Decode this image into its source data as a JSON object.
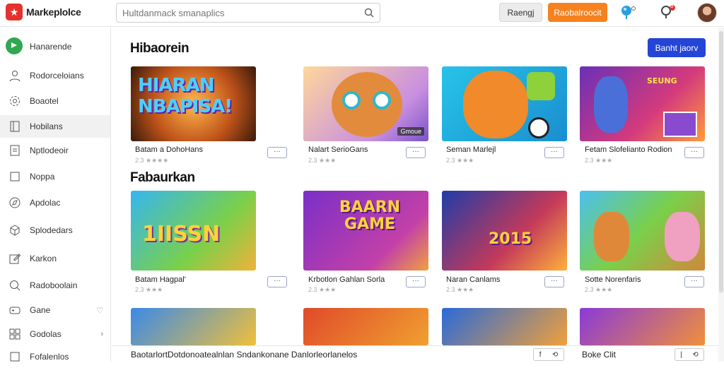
{
  "header": {
    "logo_text": "Markeplolce",
    "search_placeholder": "Hultdanmack smanaplics",
    "grey_button": "Raengj",
    "orange_button": "Raobalroocit",
    "icons": [
      "search-icon",
      "location-pin-icon",
      "notification-icon",
      "avatar"
    ],
    "notification_count": "8"
  },
  "sidebar": {
    "home_label": "Hanarende",
    "items": [
      {
        "label": "Rodorceloians",
        "icon": "user-icon"
      },
      {
        "label": "Boaotel",
        "icon": "gear-icon"
      },
      {
        "label": "Hobilans",
        "icon": "book-icon",
        "active": true
      },
      {
        "label": "Nptlodeoir",
        "icon": "document-icon"
      },
      {
        "label": "Noppa",
        "icon": "square-icon"
      },
      {
        "label": "Apdolac",
        "icon": "compass-icon"
      },
      {
        "label": "Splodedars",
        "icon": "cube-icon"
      },
      {
        "label": "Karkon",
        "icon": "edit-icon"
      },
      {
        "label": "Radoboolain",
        "icon": "search-icon"
      },
      {
        "label": "Gane",
        "icon": "gamepad-icon",
        "chevron": "♡"
      },
      {
        "label": "Godolas",
        "icon": "grid-icon",
        "chevron": "›"
      },
      {
        "label": "Fofalenlos",
        "icon": "list-icon"
      }
    ]
  },
  "main": {
    "section1_title": "Hibaorein",
    "section2_title": "Fabaurkan",
    "cta_button": "Banht jaorv",
    "row1": [
      {
        "title": "Batam a DohoHans",
        "meta": "2.3 ★★★★",
        "img_text": "HIARAN NBAPISA!"
      },
      {
        "title": "Nalart SerioGans",
        "meta": "2.3 ★★★",
        "img_text": "",
        "badge": "Gmoue"
      },
      {
        "title": "Seman Marlejl",
        "meta": "2.3 ★★★",
        "img_text": ""
      },
      {
        "title": "Fetam Slofelianto Rodion",
        "meta": "2.3 ★★★",
        "img_text": "SEUNG"
      }
    ],
    "row2": [
      {
        "title": "Batam Hagpal'",
        "meta": "2.3 ★★★",
        "img_text": "1IISSN"
      },
      {
        "title": "Krbotlon Gahlan Sorla",
        "meta": "2.3 ★★★",
        "img_text": "BAARN GAME"
      },
      {
        "title": "Naran Canlams",
        "meta": "2.3 ★★★",
        "img_text": "2015"
      },
      {
        "title": "Sotte Norenfaris",
        "meta": "2.3 ★★★",
        "img_text": ""
      }
    ],
    "more_label": "···"
  },
  "footer": {
    "text": "BaotarlortDotdonoatealnlan Sndankonane Danlorleorlanelos",
    "ctrl1": [
      "f",
      "⟲"
    ],
    "label": "Boke Clit",
    "ctrl2": [
      "|",
      "⟲"
    ]
  },
  "colors": {
    "accent_blue": "#2445d6",
    "accent_orange": "#f5821f",
    "logo_red": "#e5322d",
    "home_green": "#2fa84f"
  }
}
